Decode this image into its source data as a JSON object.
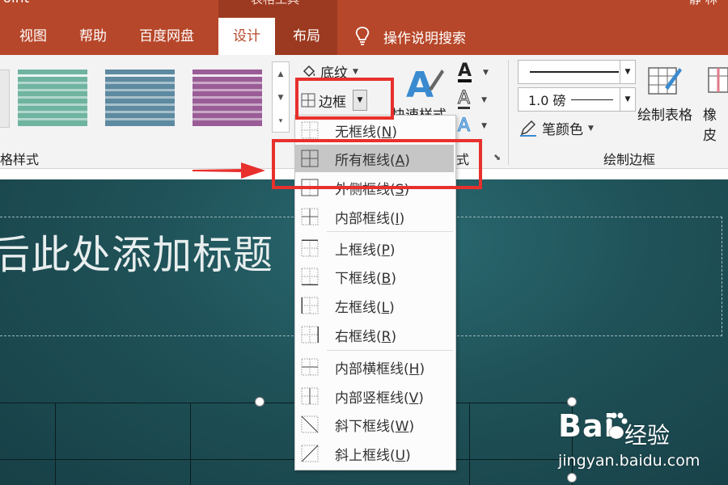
{
  "titlebar": {
    "app_name": "Point",
    "tools_label": "表格工具",
    "user_label": "静 林"
  },
  "tabs": [
    {
      "label": "视图"
    },
    {
      "label": "帮助"
    },
    {
      "label": "百度网盘"
    },
    {
      "label": "设计",
      "active": true
    },
    {
      "label": "布局"
    }
  ],
  "tell_me": {
    "label": "操作说明搜索",
    "icon": "lightbulb-icon"
  },
  "ribbon": {
    "table_styles_label": "格样式",
    "shading_label": "底纹",
    "borders_label": "边框",
    "quick_styles_label": "快速样式",
    "wordart_label": "式",
    "pen_weight_label": "1.0 磅",
    "pen_color_label": "笔颜色",
    "draw_table_label": "绘制表格",
    "eraser_label": "橡皮",
    "draw_borders_label": "绘制边框"
  },
  "swatch_colors": [
    "#6fb4a0",
    "#5d8aa0",
    "#9a5c97"
  ],
  "slide": {
    "title_text": "后此处添加标题"
  },
  "border_menu": {
    "items": [
      {
        "label": "无框线",
        "key": "N",
        "icon": "no-border-icon"
      },
      {
        "label": "所有框线",
        "key": "A",
        "icon": "all-borders-icon",
        "highlighted": true
      },
      {
        "label": "外侧框线",
        "key": "S",
        "icon": "outside-borders-icon"
      },
      {
        "label": "内部框线",
        "key": "I",
        "icon": "inside-borders-icon"
      },
      {
        "label": "上框线",
        "key": "P",
        "icon": "top-border-icon"
      },
      {
        "label": "下框线",
        "key": "B",
        "icon": "bottom-border-icon"
      },
      {
        "label": "左框线",
        "key": "L",
        "icon": "left-border-icon"
      },
      {
        "label": "右框线",
        "key": "R",
        "icon": "right-border-icon"
      },
      {
        "label": "内部横框线",
        "key": "H",
        "icon": "inside-horizontal-border-icon"
      },
      {
        "label": "内部竖框线",
        "key": "V",
        "icon": "inside-vertical-border-icon"
      },
      {
        "label": "斜下框线",
        "key": "W",
        "icon": "diagonal-down-border-icon"
      },
      {
        "label": "斜上框线",
        "key": "U",
        "icon": "diagonal-up-border-icon"
      }
    ]
  },
  "watermark": {
    "brand": "Bai",
    "brand_cn": "经验",
    "url": "jingyan.baidu.com"
  },
  "annotation_color": "#e8302c",
  "accent_color": "#b7472a"
}
